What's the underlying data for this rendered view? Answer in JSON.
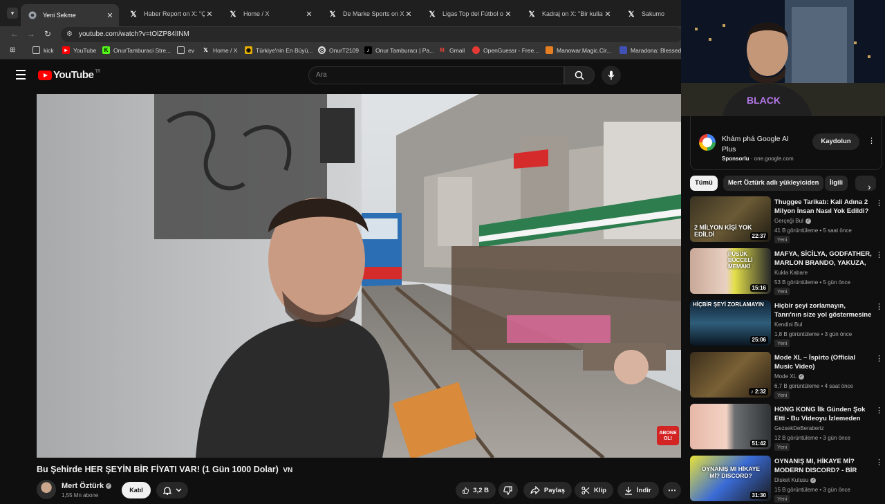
{
  "browser": {
    "tabs": [
      {
        "title": "Yeni Sekme",
        "icon": "chrome-icon",
        "active": true
      },
      {
        "title": "Haber Report on X: \"Çatış",
        "icon": "x-logo-icon"
      },
      {
        "title": "Home / X",
        "icon": "x-logo-icon"
      },
      {
        "title": "De Marke Sports on X: \"B",
        "icon": "x-logo-icon"
      },
      {
        "title": "Ligas Top del Fútbol on X",
        "icon": "x-logo-icon"
      },
      {
        "title": "Kadraj on X: \"Bir kullanıcı",
        "icon": "x-logo-icon"
      },
      {
        "title": "Sakumo",
        "icon": "x-logo-icon"
      }
    ],
    "url": "youtube.com/watch?v=tOlZP84lINM",
    "bookmarks": [
      {
        "label": "kick",
        "icon": "folder-icon"
      },
      {
        "label": "YouTube",
        "icon": "youtube-icon"
      },
      {
        "label": "OnurTamburaci Stre...",
        "icon": "kick-icon"
      },
      {
        "label": "ev",
        "icon": "folder-icon"
      },
      {
        "label": "Home / X",
        "icon": "x-logo-icon"
      },
      {
        "label": "Türkiye'nin En Büyü...",
        "icon": "site-icon"
      },
      {
        "label": "OnurT2109",
        "icon": "site-icon"
      },
      {
        "label": "Onur Tamburacı | Pa...",
        "icon": "tiktok-icon"
      },
      {
        "label": "Gmail",
        "icon": "gmail-icon"
      },
      {
        "label": "OpenGuessr - Free...",
        "icon": "site-icon"
      },
      {
        "label": "Manowar.Magic.Cir...",
        "icon": "site-icon"
      },
      {
        "label": "Maradona: Blessed...",
        "icon": "site-icon"
      }
    ]
  },
  "youtube": {
    "logo_text": "YouTube",
    "logo_region": "TR",
    "search_placeholder": "Ara"
  },
  "video": {
    "title": "Bu Şehirde HER ŞEYİN BİR FİYATI VAR! (1 Gün 1000 Dolar)",
    "title_flag": "VN",
    "overlay_badge": "ABONE OL!",
    "channel_name": "Mert Öztürk",
    "channel_subs": "1,55 Mn abone",
    "join_label": "Katıl",
    "likes": "3,2 B",
    "share_label": "Paylaş",
    "clip_label": "Klip",
    "download_label": "İndir"
  },
  "sidebar": {
    "ad": {
      "title": "Khám phá Google AI Plus",
      "sponsor_label": "Sponsorlu",
      "sponsor_domain": "one.google.com",
      "button": "Kaydolun"
    },
    "chips": [
      "Tümü",
      "Mert Öztürk adlı yükleyiciden",
      "İlgili"
    ],
    "recommendations": [
      {
        "title": "Thuggee Tarikatı: Kali Adına 2 Milyon İnsan Nasıl Yok Edildi?",
        "channel": "Gerçeği Bul",
        "verified": true,
        "views": "41 B görüntüleme",
        "age": "5 saat önce",
        "badge": "Yeni",
        "duration": "22:37",
        "thumb_text": "2 MİLYON KİŞİ YOK EDİLDİ"
      },
      {
        "title": "MAFYA, SİCİLYA, GODFATHER, MARLON BRANDO, YAKUZA, ...",
        "channel": "Kukla Kabare",
        "verified": false,
        "views": "53 B görüntüleme",
        "age": "5 gün önce",
        "badge": "Yeni",
        "duration": "15:16",
        "thumb_text": "PÜSÜK BÜCCELİ MEMAKİ"
      },
      {
        "title": "Hiçbir şeyi zorlamayın, Tanrı'nın size yol göstermesine izin veri...",
        "channel": "Kendini Bul",
        "verified": false,
        "views": "1,8 B görüntüleme",
        "age": "3 gün önce",
        "badge": "Yeni",
        "duration": "25:06",
        "thumb_text": "HİÇBİR ŞEYİ ZORLAMAYIN"
      },
      {
        "title": "Mode XL – İspirto (Official Music Video)",
        "channel": "Mode XL",
        "verified": true,
        "views": "6,7 B görüntüleme",
        "age": "4 saat önce",
        "badge": "Yeni",
        "duration": "2:32",
        "thumb_text": ""
      },
      {
        "title": "HONG KONG İlk Günden Şok Etti - Bu Videoyu İzlemeden HONG...",
        "channel": "GezsekDeBeraberiz",
        "verified": false,
        "views": "12 B görüntüleme",
        "age": "3 gün önce",
        "badge": "Yeni",
        "duration": "51:42",
        "thumb_text": ""
      },
      {
        "title": "OYNANIŞ MI, HİKAYE Mİ? MODERN DISCORD? - BİR İNSAN...",
        "channel": "Disket Kutusu",
        "verified": true,
        "views": "15 B görüntüleme",
        "age": "3 gün önce",
        "badge": "Yeni",
        "duration": "31:30",
        "thumb_text": "OYNANIŞ MI HİKAYE Mİ? DISCORD?"
      }
    ]
  },
  "colors": {
    "background": "#0f0f0f",
    "brand_red": "#ff0000",
    "chip_bg": "#272727"
  }
}
